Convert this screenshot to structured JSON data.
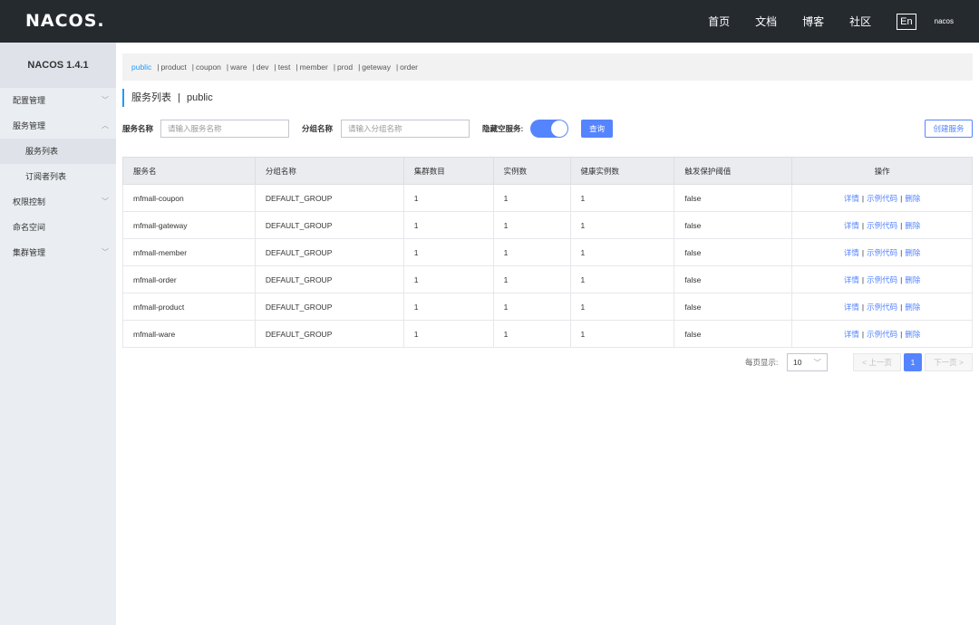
{
  "header": {
    "logo": "NACOS.",
    "nav": [
      "首页",
      "文档",
      "博客",
      "社区"
    ],
    "lang": "En",
    "user": "nacos"
  },
  "sidebar": {
    "version": "NACOS 1.4.1",
    "items": [
      {
        "label": "配置管理",
        "arrow": "﹀"
      },
      {
        "label": "服务管理",
        "arrow": "︿"
      },
      {
        "label": "服务列表",
        "arrow": ""
      },
      {
        "label": "订阅者列表",
        "arrow": ""
      },
      {
        "label": "权限控制",
        "arrow": "﹀"
      },
      {
        "label": "命名空间",
        "arrow": ""
      },
      {
        "label": "集群管理",
        "arrow": "﹀"
      }
    ]
  },
  "namespaces": [
    "public",
    "product",
    "coupon",
    "ware",
    "dev",
    "test",
    "member",
    "prod",
    "geteway",
    "order"
  ],
  "page": {
    "title": "服务列表",
    "separator": "|",
    "namespace": "public"
  },
  "filter": {
    "service_label": "服务名称",
    "service_placeholder": "请输入服务名称",
    "group_label": "分组名称",
    "group_placeholder": "请输入分组名称",
    "hide_empty_label": "隐藏空服务:",
    "hide_empty_on": true,
    "query_button": "查询",
    "create_button": "创建服务"
  },
  "table": {
    "headers": [
      "服务名",
      "分组名称",
      "集群数目",
      "实例数",
      "健康实例数",
      "触发保护阈值",
      "操作"
    ],
    "rows": [
      [
        "mfmall-coupon",
        "DEFAULT_GROUP",
        "1",
        "1",
        "1",
        "false"
      ],
      [
        "mfmall-gateway",
        "DEFAULT_GROUP",
        "1",
        "1",
        "1",
        "false"
      ],
      [
        "mfmall-member",
        "DEFAULT_GROUP",
        "1",
        "1",
        "1",
        "false"
      ],
      [
        "mfmall-order",
        "DEFAULT_GROUP",
        "1",
        "1",
        "1",
        "false"
      ],
      [
        "mfmall-product",
        "DEFAULT_GROUP",
        "1",
        "1",
        "1",
        "false"
      ],
      [
        "mfmall-ware",
        "DEFAULT_GROUP",
        "1",
        "1",
        "1",
        "false"
      ]
    ],
    "ops": [
      "详情",
      "示例代码",
      "删除"
    ]
  },
  "pagination": {
    "page_size_label": "每页显示:",
    "page_size": "10",
    "prev": "< 上一页",
    "current": "1",
    "next": "下一页 >"
  },
  "colors": {
    "accent": "#5584ff",
    "topbar": "#252a2f",
    "sidebar": "#eaedf1",
    "link": "#209bfa"
  }
}
